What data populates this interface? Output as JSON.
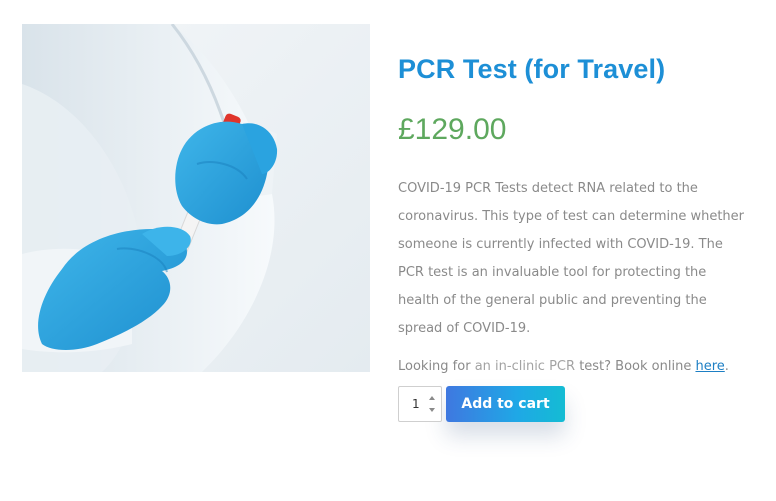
{
  "product": {
    "image_alt": "gloved hands holding test tube",
    "title": "PCR Test (for Travel)",
    "price": "£129.00",
    "description": "COVID-19 PCR Tests detect RNA related to the coronavirus. This type of test can determine whether someone is currently infected with COVID-19. The PCR test is an invaluable tool for protecting the health of the general public and preventing the spread of COVID-19.",
    "booking": {
      "prefix": "Looking for",
      "dim": "an in-clinic PCR",
      "middle": "test? Book online",
      "link": "here",
      "suffix": "."
    }
  },
  "cart": {
    "quantity": "1",
    "add_label": "Add to cart"
  },
  "colors": {
    "title": "#1d8fd6",
    "price": "#5ea85e",
    "button_start": "#3f78e0",
    "button_end": "#14bcd3",
    "link": "#1d7fc4"
  }
}
